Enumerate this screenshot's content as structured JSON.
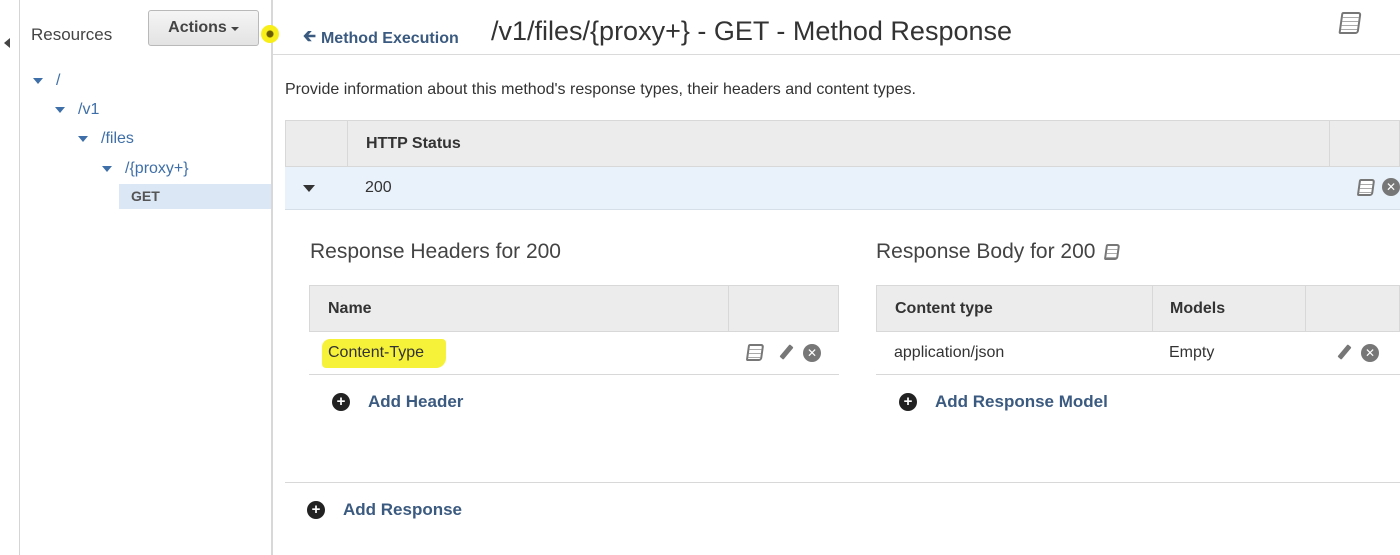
{
  "sidebar": {
    "title": "Resources",
    "actions_label": "Actions",
    "tree": [
      {
        "label": "/"
      },
      {
        "label": "/v1"
      },
      {
        "label": "/files"
      },
      {
        "label": "/{proxy+}"
      }
    ],
    "selected_method": "GET"
  },
  "header": {
    "back_label": "Method Execution",
    "title": "/v1/files/{proxy+} - GET - Method Response"
  },
  "description": "Provide information about this method's response types, their headers and content types.",
  "status_table": {
    "header": "HTTP Status",
    "rows": [
      {
        "code": "200"
      }
    ]
  },
  "headers_section": {
    "title": "Response Headers for 200",
    "column": "Name",
    "rows": [
      {
        "name": "Content-Type"
      }
    ],
    "add_label": "Add Header"
  },
  "body_section": {
    "title": "Response Body for 200",
    "columns": [
      "Content type",
      "Models"
    ],
    "rows": [
      {
        "content_type": "application/json",
        "model": "Empty"
      }
    ],
    "add_label": "Add Response Model"
  },
  "add_response_label": "Add Response",
  "colors": {
    "link": "#3b5a80",
    "tree_link": "#3f6fa8",
    "selected_row": "#e9f1fa",
    "highlight": "#f6f23a"
  }
}
